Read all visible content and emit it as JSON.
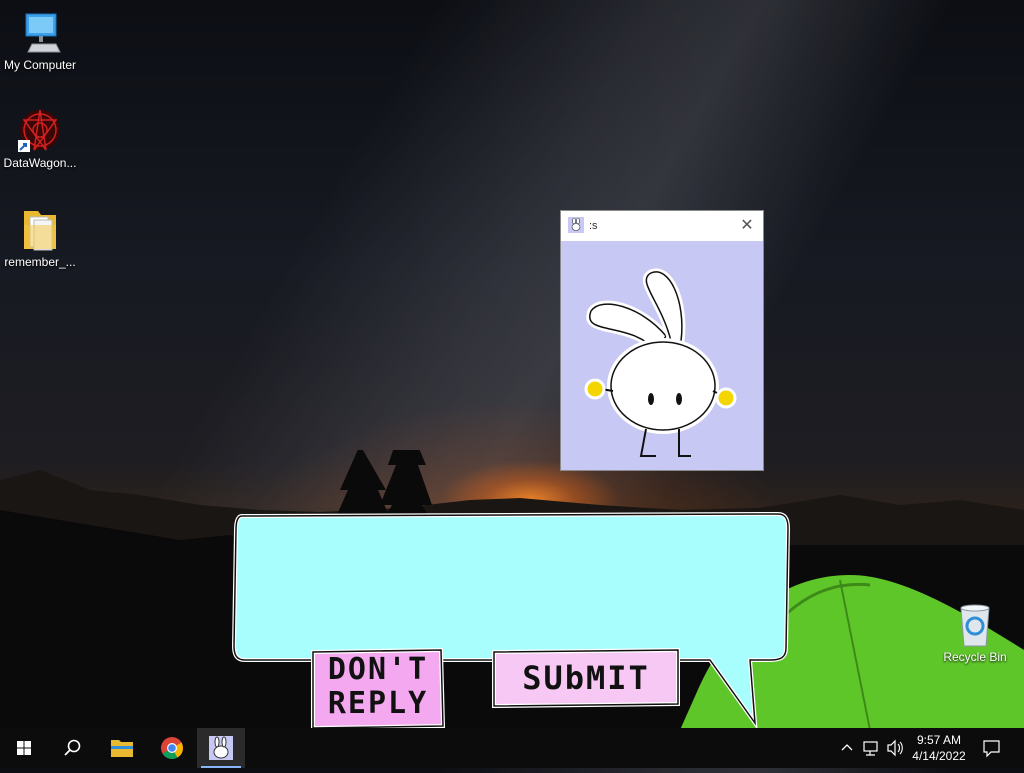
{
  "desktop": {
    "icons": [
      {
        "label": "My Computer",
        "icon": "computer-icon"
      },
      {
        "label": "DataWagon...",
        "icon": "datawagon-icon"
      },
      {
        "label": "remember_...",
        "icon": "folder-icon"
      },
      {
        "label": "Recycle Bin",
        "icon": "recycle-bin-icon"
      }
    ]
  },
  "popup": {
    "title": ":s",
    "close_icon": "close-icon",
    "background": "#c8c8f5"
  },
  "reply": {
    "value": "",
    "bubble_color": "#a8fdfd",
    "dont_reply_line1": "DON'T",
    "dont_reply_line2": "REPLY",
    "dont_reply_color": "#f4a8f0",
    "submit_label": "SUbMIT",
    "submit_color": "#f8c8f4"
  },
  "taskbar": {
    "start_icon": "windows-start-icon",
    "search_icon": "search-icon",
    "pinned": [
      "file-explorer-icon",
      "chrome-icon",
      "bunny-app-icon"
    ],
    "tray": [
      "chevron-up-icon",
      "network-icon",
      "volume-icon",
      "notification-icon"
    ],
    "time": "9:57 AM",
    "date": "4/14/2022"
  }
}
